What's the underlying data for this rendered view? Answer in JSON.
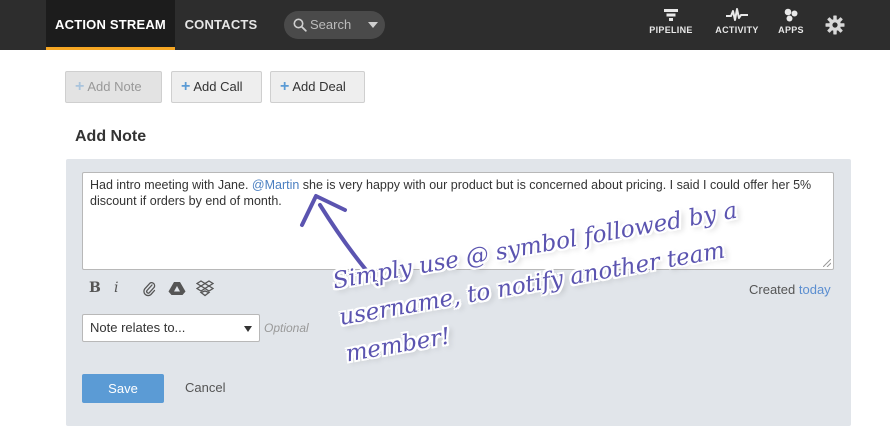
{
  "topbar": {
    "tabs": [
      {
        "label": "ACTION STREAM",
        "active": true
      },
      {
        "label": "CONTACTS",
        "active": false
      }
    ],
    "search": {
      "placeholder": "Search"
    },
    "nav": [
      {
        "label": "PIPELINE",
        "icon": "filter-icon"
      },
      {
        "label": "ACTIVITY",
        "icon": "pulse-icon"
      },
      {
        "label": "APPS",
        "icon": "apps-icon"
      },
      {
        "label": "",
        "icon": "gear-icon"
      }
    ]
  },
  "actions": {
    "add_note": "Add Note",
    "add_call": "Add Call",
    "add_deal": "Add Deal"
  },
  "form": {
    "title": "Add Note",
    "note_before": "Had intro meeting with Jane. ",
    "note_mention": "@Martin",
    "note_after": " she is very happy with our product but is concerned about pricing. I said I could offer her 5% discount if orders by end of month.",
    "toolbar": {
      "bold": "B",
      "italic": "i"
    },
    "created_label": "Created",
    "created_value": "today",
    "relates_to": "Note relates to...",
    "optional": "Optional",
    "save": "Save",
    "cancel": "Cancel"
  },
  "annotation": {
    "text": "Simply use @ symbol followed by a username, to notify another team member!"
  },
  "colors": {
    "topbar": "#2d2d2d",
    "accent_underline": "#f5a623",
    "primary": "#5b9bd5",
    "panel": "#e1e5ea",
    "annotation": "#5b54b0"
  }
}
